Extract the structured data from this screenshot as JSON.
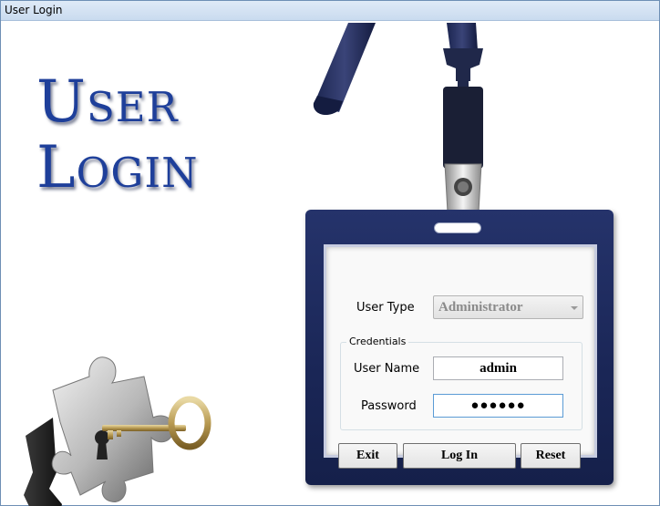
{
  "window": {
    "title": "User Login"
  },
  "logo": {
    "line1": "User",
    "line2": "Login"
  },
  "form": {
    "user_type_label": "User Type",
    "user_type_value": "Administrator",
    "credentials_title": "Credentials",
    "username_label": "User Name",
    "username_value": "admin",
    "password_label": "Password",
    "password_value": "●●●●●●"
  },
  "buttons": {
    "exit": "Exit",
    "login": "Log In",
    "reset": "Reset"
  },
  "colors": {
    "logo_blue": "#1e3f9a",
    "badge_navy": "#1a2656",
    "focus_border": "#5b9bd5"
  },
  "icons": {
    "puzzle_key": "puzzle-key-icon",
    "lanyard": "lanyard-icon",
    "dropdown_arrow": "chevron-down-icon"
  }
}
